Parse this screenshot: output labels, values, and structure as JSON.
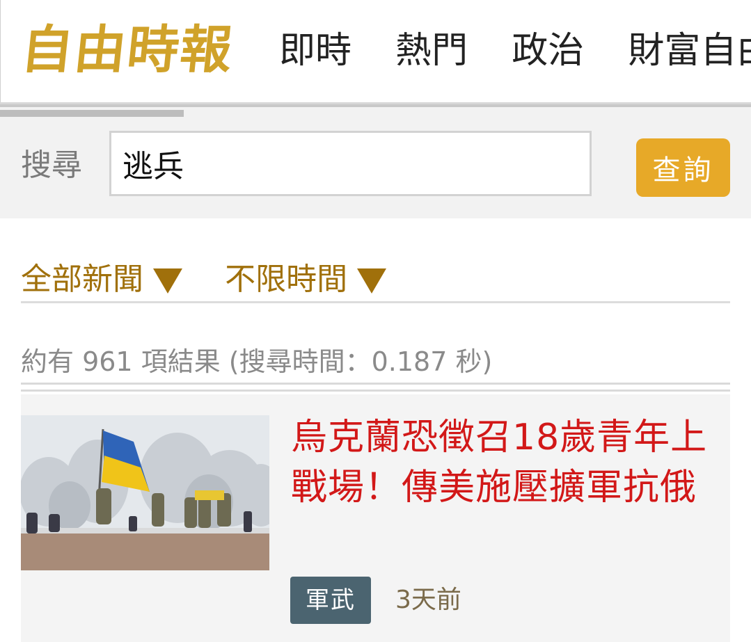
{
  "header": {
    "logo_text": "自由時報",
    "nav": [
      "即時",
      "熱門",
      "政治",
      "財富自由"
    ]
  },
  "search": {
    "label": "搜尋",
    "value": "逃兵",
    "button_label": "查詢"
  },
  "filters": {
    "category": "全部新聞",
    "time_range": "不限時間"
  },
  "results": {
    "summary": "約有 961 項結果 (搜尋時間：0.187 秒)",
    "items": [
      {
        "headline": "烏克蘭恐徵召18歲青年上戰場！傳美施壓擴軍抗俄",
        "category": "軍武",
        "time_ago": "3天前"
      }
    ]
  },
  "colors": {
    "logo_gold": "#d0a22a",
    "accent_button": "#e7a928",
    "filter_brown": "#a0700b",
    "headline_red": "#d21818",
    "badge_slate": "#4b6470"
  },
  "icons": {
    "dropdown": "triangle-down-icon"
  }
}
